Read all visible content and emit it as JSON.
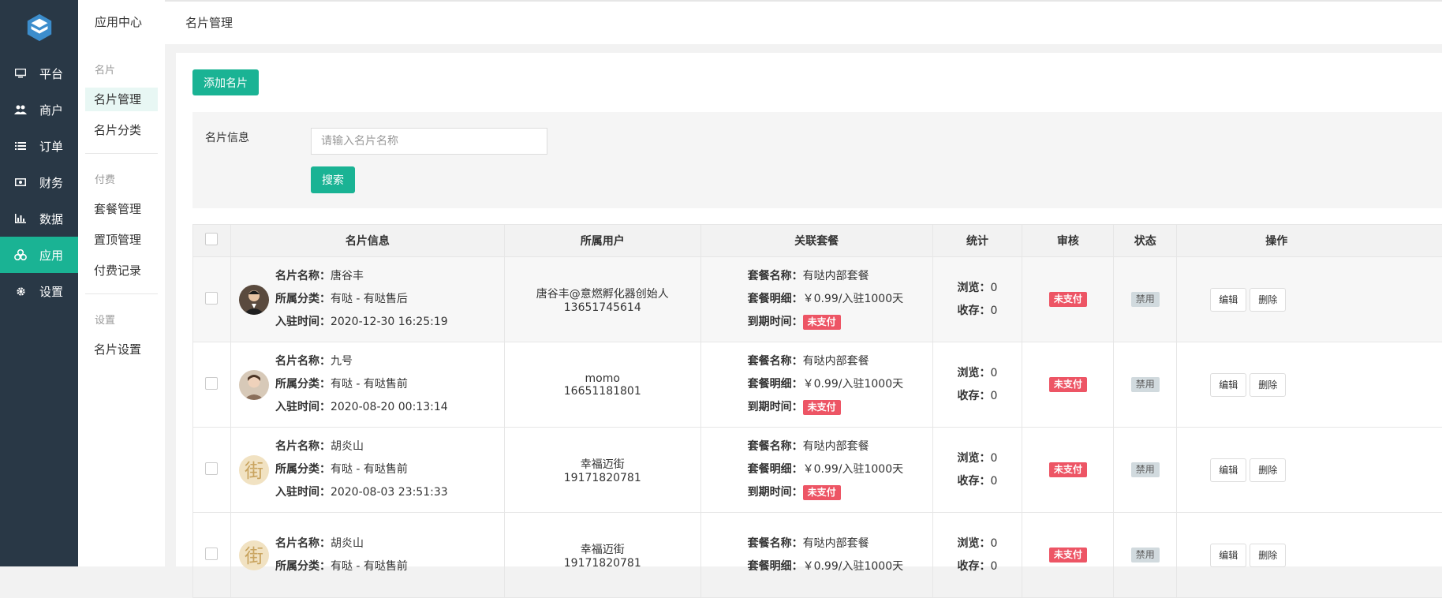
{
  "nav": {
    "items": [
      {
        "label": "平台",
        "icon": "monitor-icon"
      },
      {
        "label": "商户",
        "icon": "users-icon"
      },
      {
        "label": "订单",
        "icon": "list-icon"
      },
      {
        "label": "财务",
        "icon": "money-icon"
      },
      {
        "label": "数据",
        "icon": "bar-chart-icon"
      },
      {
        "label": "应用",
        "icon": "apps-icon"
      },
      {
        "label": "设置",
        "icon": "gear-icon"
      }
    ],
    "active_index": 5
  },
  "subnav": {
    "title": "应用中心",
    "groups": [
      {
        "label": "名片",
        "items": [
          "名片管理",
          "名片分类"
        ]
      },
      {
        "label": "付费",
        "items": [
          "套餐管理",
          "置顶管理",
          "付费记录"
        ]
      },
      {
        "label": "设置",
        "items": [
          "名片设置"
        ]
      }
    ]
  },
  "header": {
    "breadcrumb": "名片管理"
  },
  "toolbar": {
    "add_label": "添加名片"
  },
  "filter": {
    "label": "名片信息",
    "placeholder": "请输入名片名称",
    "value": "",
    "search_label": "搜索"
  },
  "table": {
    "headers": [
      "名片信息",
      "所属用户",
      "关联套餐",
      "统计",
      "审核",
      "状态",
      "操作"
    ],
    "field_labels": {
      "name": "名片名称：",
      "category": "所属分类：",
      "joined": "入驻时间：",
      "package_name": "套餐名称：",
      "package_detail": "套餐明细：",
      "expire": "到期时间：",
      "views": "浏览：",
      "favorites": "收存："
    },
    "rows": [
      {
        "name": "唐谷丰",
        "category": "有哒 - 有哒售后",
        "joined": "2020-12-30 16:25:19",
        "user": "唐谷丰@意燃孵化器创始人",
        "phone": "13651745614",
        "package_name": "有哒内部套餐",
        "package_detail": "￥0.99/入驻1000天",
        "expire": "未支付",
        "views": "0",
        "favorites": "0",
        "review": "未支付",
        "status": "禁用",
        "edit": "编辑",
        "delete": "删除"
      },
      {
        "name": "九号",
        "category": "有哒 - 有哒售前",
        "joined": "2020-08-20 00:13:14",
        "user": "momo",
        "phone": "16651181801",
        "package_name": "有哒内部套餐",
        "package_detail": "￥0.99/入驻1000天",
        "expire": "未支付",
        "views": "0",
        "favorites": "0",
        "review": "未支付",
        "status": "禁用",
        "edit": "编辑",
        "delete": "删除"
      },
      {
        "name": "胡炎山",
        "category": "有哒 - 有哒售前",
        "joined": "2020-08-03 23:51:33",
        "user": "幸福迈街",
        "phone": "19171820781",
        "package_name": "有哒内部套餐",
        "package_detail": "￥0.99/入驻1000天",
        "expire": "未支付",
        "views": "0",
        "favorites": "0",
        "review": "未支付",
        "status": "禁用",
        "edit": "编辑",
        "delete": "删除"
      },
      {
        "name": "胡炎山",
        "category": "有哒 - 有哒售前",
        "joined": "",
        "user": "幸福迈街",
        "phone": "19171820781",
        "package_name": "有哒内部套餐",
        "package_detail": "￥0.99/入驻1000天",
        "expire": "",
        "views": "0",
        "favorites": "0",
        "review": "未支付",
        "status": "禁用",
        "edit": "编辑",
        "delete": "删除"
      }
    ]
  },
  "colors": {
    "nav_bg": "#293846",
    "accent": "#1ab394",
    "danger": "#ed5565",
    "muted_badge": "#d1dade"
  }
}
